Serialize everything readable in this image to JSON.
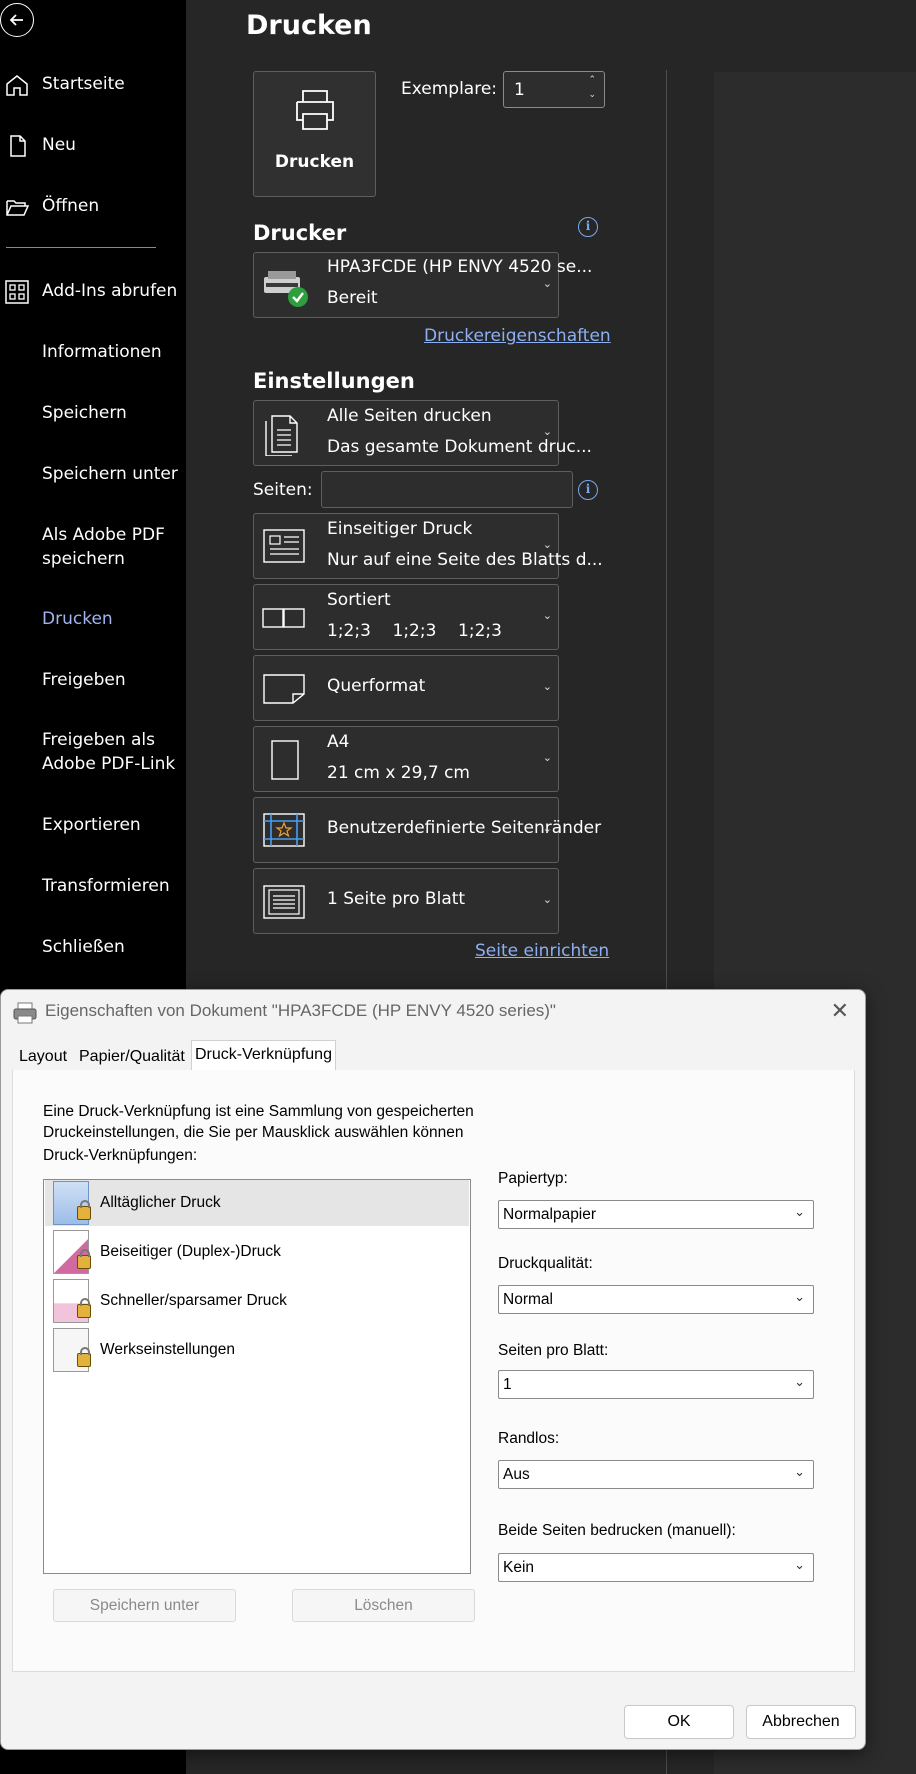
{
  "sidebar": {
    "items": [
      {
        "label": "Startseite",
        "icon": "home-icon"
      },
      {
        "label": "Neu",
        "icon": "new-document-icon"
      },
      {
        "label": "Öffnen",
        "icon": "folder-open-icon"
      },
      {
        "label": "Add-Ins abrufen",
        "icon": "add-ins-grid-icon"
      },
      {
        "label": "Informationen"
      },
      {
        "label": "Speichern"
      },
      {
        "label": "Speichern unter"
      },
      {
        "label": "Als Adobe PDF speichern",
        "line1": "Als Adobe PDF",
        "line2": "speichern"
      },
      {
        "label": "Drucken",
        "active": true
      },
      {
        "label": "Freigeben"
      },
      {
        "label": "Freigeben als Adobe PDF-Link",
        "line1": "Freigeben als",
        "line2": "Adobe PDF-Link"
      },
      {
        "label": "Exportieren"
      },
      {
        "label": "Transformieren"
      },
      {
        "label": "Schließen"
      }
    ]
  },
  "print": {
    "title": "Drucken",
    "print_button": "Drucken",
    "copies_label": "Exemplare:",
    "copies_value": "1",
    "printer_heading": "Drucker",
    "printer_name": "HPA3FCDE (HP ENVY 4520 se...",
    "printer_status": "Bereit",
    "printer_properties_link": "Druckereigenschaften",
    "settings_heading": "Einstellungen",
    "pages_label": "Seiten:",
    "pages_value": "",
    "settings": {
      "range": {
        "line1": "Alle Seiten drucken",
        "line2": "Das gesamte Dokument druc..."
      },
      "sides": {
        "line1": "Einseitiger Druck",
        "line2": "Nur auf eine Seite des Blatts d..."
      },
      "collate": {
        "line1": "Sortiert",
        "line2": "1;2;3    1;2;3    1;2;3"
      },
      "orientation": {
        "line1": "Querformat"
      },
      "paper": {
        "line1": "A4",
        "line2": "21 cm x 29,7 cm"
      },
      "margins": {
        "line1": "Benutzerdefinierte Seitenränder"
      },
      "pages_per_sheet": {
        "line1": "1 Seite pro Blatt"
      }
    },
    "page_setup_link": "Seite einrichten"
  },
  "dialog": {
    "title": "Eigenschaften von Dokument \"HPA3FCDE (HP ENVY 4520 series)\"",
    "tabs": [
      "Layout",
      "Papier/Qualität",
      "Druck-Verknüpfung"
    ],
    "active_tab": "Druck-Verknüpfung",
    "description_line1": "Eine Druck-Verknüpfung ist eine Sammlung von gespeicherten",
    "description_line2": "Druckeinstellungen, die Sie per Mausklick auswählen können",
    "shortcuts_label": "Druck-Verknüpfungen:",
    "shortcuts": [
      {
        "label": "Alltäglicher Druck",
        "selected": true
      },
      {
        "label": "Beiseitiger (Duplex-)Druck"
      },
      {
        "label": "Schneller/sparsamer Druck"
      },
      {
        "label": "Werkseinstellungen"
      }
    ],
    "save_as_button": "Speichern unter",
    "delete_button": "Löschen",
    "fields": {
      "paper_type": {
        "label": "Papiertyp:",
        "value": "Normalpapier"
      },
      "quality": {
        "label": "Druckqualität:",
        "value": "Normal"
      },
      "pages_per_sheet": {
        "label": "Seiten pro Blatt:",
        "value": "1"
      },
      "borderless": {
        "label": "Randlos:",
        "value": "Aus"
      },
      "duplex_manual": {
        "label": "Beide Seiten bedrucken (manuell):",
        "value": "Kein"
      }
    },
    "ok_button": "OK",
    "cancel_button": "Abbrechen"
  }
}
